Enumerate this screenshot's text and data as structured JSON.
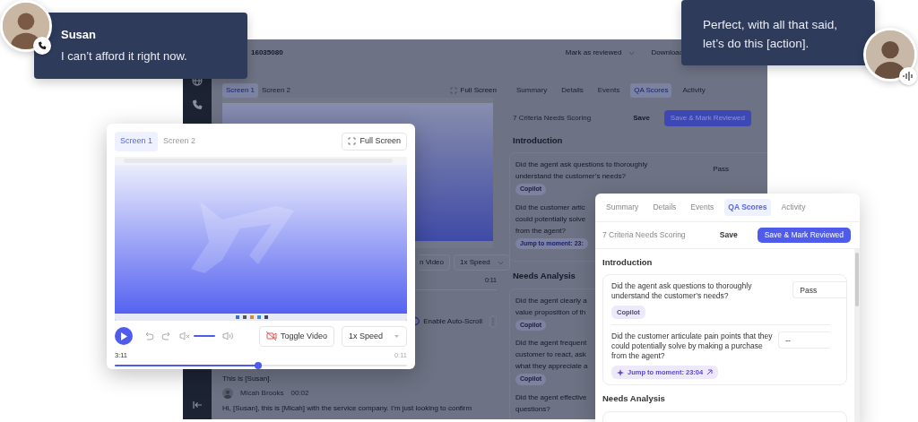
{
  "caller_bubble": {
    "name": "Susan",
    "message": "I can’t afford it right now."
  },
  "agent_bubble": {
    "message": "Perfect, with all that said, let’s do this [action]."
  },
  "background_app": {
    "record_id": "16035080",
    "header_actions": [
      {
        "label": "Mark as reviewed",
        "kind": "dropdown"
      },
      {
        "label": "Download",
        "kind": "plain"
      }
    ],
    "screen_tabs": [
      {
        "label": "Screen 1",
        "selected": true
      },
      {
        "label": "Screen 2",
        "selected": false
      }
    ],
    "full_screen": "Full Screen",
    "toggle_video": "n Video",
    "speed": "1x Speed",
    "duration": "0:11",
    "auto_scroll": "Enable Auto-Scroll",
    "transcript": [
      {
        "kind": "line",
        "text": "This is [Susan]."
      },
      {
        "kind": "speaker",
        "name": "Micah Brooks",
        "time": "00:02"
      },
      {
        "kind": "line",
        "text": "Hi, [Susan], this is [Micah] with the service company. I’m just looking to confirm"
      }
    ],
    "qa_tabs": [
      {
        "label": "Summary",
        "selected": false
      },
      {
        "label": "Details",
        "selected": false
      },
      {
        "label": "Events",
        "selected": false
      },
      {
        "label": "QA Scores",
        "selected": true
      },
      {
        "label": "Activity",
        "selected": false
      }
    ],
    "criteria": "7 Criteria Needs Scoring",
    "save": "Save",
    "save_review": "Save & Mark Reviewed",
    "sections": [
      {
        "title": "Introduction",
        "questions": [
          {
            "lines": [
              "Did the agent ask questions to thoroughly",
              "understand the customer’s needs?"
            ],
            "answer": "Pass",
            "tag": {
              "kind": "copilot",
              "label": "Copilot"
            }
          },
          {
            "lines": [
              "Did the customer artic",
              "could potentially solve",
              "from the agent?"
            ],
            "tag": {
              "kind": "jump",
              "label": "Jump to moment: 23:"
            }
          }
        ]
      },
      {
        "title": "Needs Analysis",
        "questions": [
          {
            "lines": [
              "Did the agent clearly a",
              "value proposition of th"
            ],
            "tag": {
              "kind": "copilot",
              "label": "Copilot"
            }
          },
          {
            "lines": [
              "Did the agent frequent",
              "customer to react, ask",
              "what they appreciate a"
            ],
            "tag": {
              "kind": "copilot",
              "label": "Copilot"
            }
          },
          {
            "lines": [
              "Did the agent effective",
              "questions?"
            ]
          }
        ]
      }
    ]
  },
  "video_card": {
    "tabs": [
      {
        "label": "Screen 1",
        "selected": true
      },
      {
        "label": "Screen 2",
        "selected": false
      }
    ],
    "full_screen": "Full Screen",
    "volume": {
      "level": 1
    },
    "toggle_video": "Toggle Video",
    "speed": "1x Speed",
    "elapsed": "3:11",
    "duration": "0:11",
    "progress": {
      "level": 0.49
    }
  },
  "qa_card": {
    "tabs": [
      {
        "label": "Summary",
        "selected": false
      },
      {
        "label": "Details",
        "selected": false
      },
      {
        "label": "Events",
        "selected": false
      },
      {
        "label": "QA Scores",
        "selected": true
      },
      {
        "label": "Activity",
        "selected": false
      }
    ],
    "criteria": "7 Criteria Needs Scoring",
    "save": "Save",
    "save_review": "Save & Mark Reviewed",
    "sections": [
      {
        "title": "Introduction",
        "questions": [
          {
            "text": "Did the agent ask questions to thoroughly understand the customer’s needs?",
            "answer": "Pass",
            "tag": {
              "kind": "copilot",
              "label": "Copilot"
            }
          },
          {
            "text": "Did the customer articulate pain points that they could potentially solve by making a purchase from the agent?",
            "answer": "--",
            "tag": {
              "kind": "jump",
              "label": "Jump to moment: 23:04"
            }
          }
        ]
      },
      {
        "title": "Needs Analysis"
      }
    ]
  }
}
